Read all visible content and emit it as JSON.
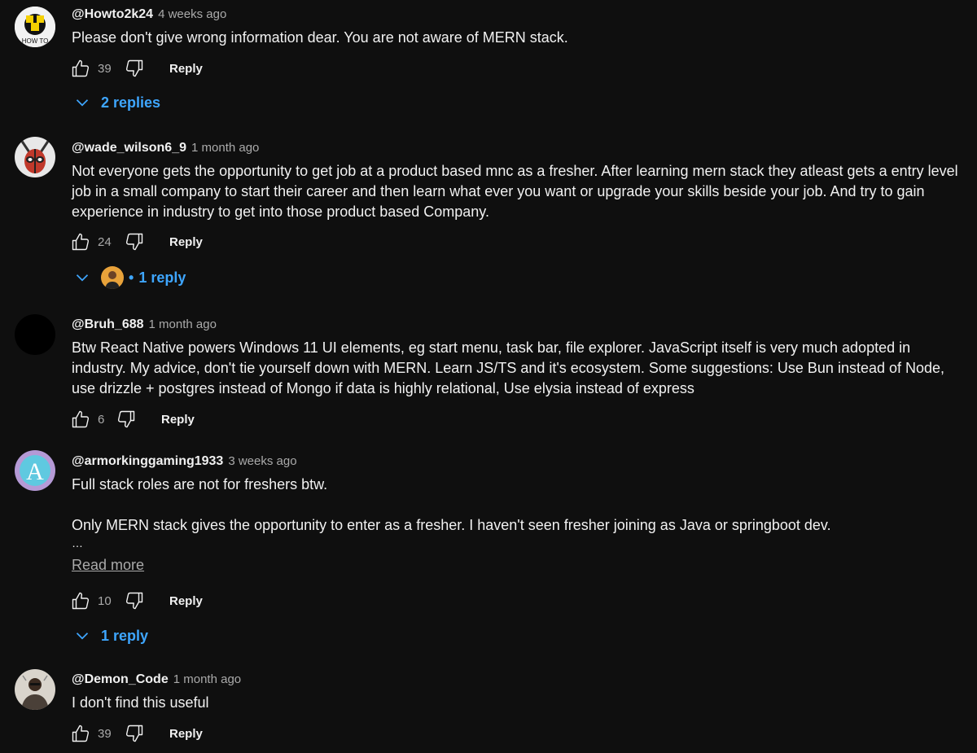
{
  "comments": [
    {
      "author": "@Howto2k24",
      "time": "4 weeks ago",
      "avatar_icon": "how-to-logo-icon",
      "lines": [
        "Please don't give wrong information dear. You are not aware of MERN stack."
      ],
      "likes": "39",
      "reply_label": "Reply",
      "replies_label": "2 replies"
    },
    {
      "author": "@wade_wilson6_9",
      "time": "1 month ago",
      "avatar_icon": "deadpool-avatar-icon",
      "lines": [
        "Not everyone gets the opportunity to get job at a product based mnc as a fresher. After learning mern stack they atleast gets a entry level job in a small company to start their career and then learn what ever you want or upgrade your skills beside your job. And try to gain experience in industry to get into those product based Company."
      ],
      "likes": "24",
      "reply_label": "Reply",
      "replies_label": "1 reply"
    },
    {
      "author": "@Bruh_688",
      "time": "1 month ago",
      "avatar_icon": "black-avatar-icon",
      "lines": [
        "Btw React Native powers Windows 11 UI elements, eg start menu, task bar, file explorer. JavaScript itself is very much adopted in industry. My advice, don't tie yourself down with MERN. Learn JS/TS and it's ecosystem. Some suggestions: Use Bun instead of Node, use drizzle + postgres instead of Mongo if data is highly relational, Use elysia instead of express"
      ],
      "likes": "6",
      "reply_label": "Reply"
    },
    {
      "author": "@armorkinggaming1933",
      "time": "3 weeks ago",
      "avatar_icon": "letter-a-avatar-icon",
      "avatar_letter": "A",
      "lines": [
        "Full stack roles are not for freshers btw.",
        "",
        "Only MERN stack gives the opportunity to enter as a fresher. I haven't seen fresher joining as Java or springboot dev.",
        "…"
      ],
      "read_more": "Read more",
      "likes": "10",
      "reply_label": "Reply",
      "replies_label": "1 reply"
    },
    {
      "author": "@Demon_Code",
      "time": "1 month ago",
      "avatar_icon": "photo-avatar-icon",
      "lines": [
        "I don't find this useful"
      ],
      "likes": "39",
      "reply_label": "Reply"
    }
  ],
  "colors": {
    "background": "#0f0f0f",
    "text": "#f1f1f1",
    "secondary": "#aaaaaa",
    "link": "#3ea6ff"
  }
}
